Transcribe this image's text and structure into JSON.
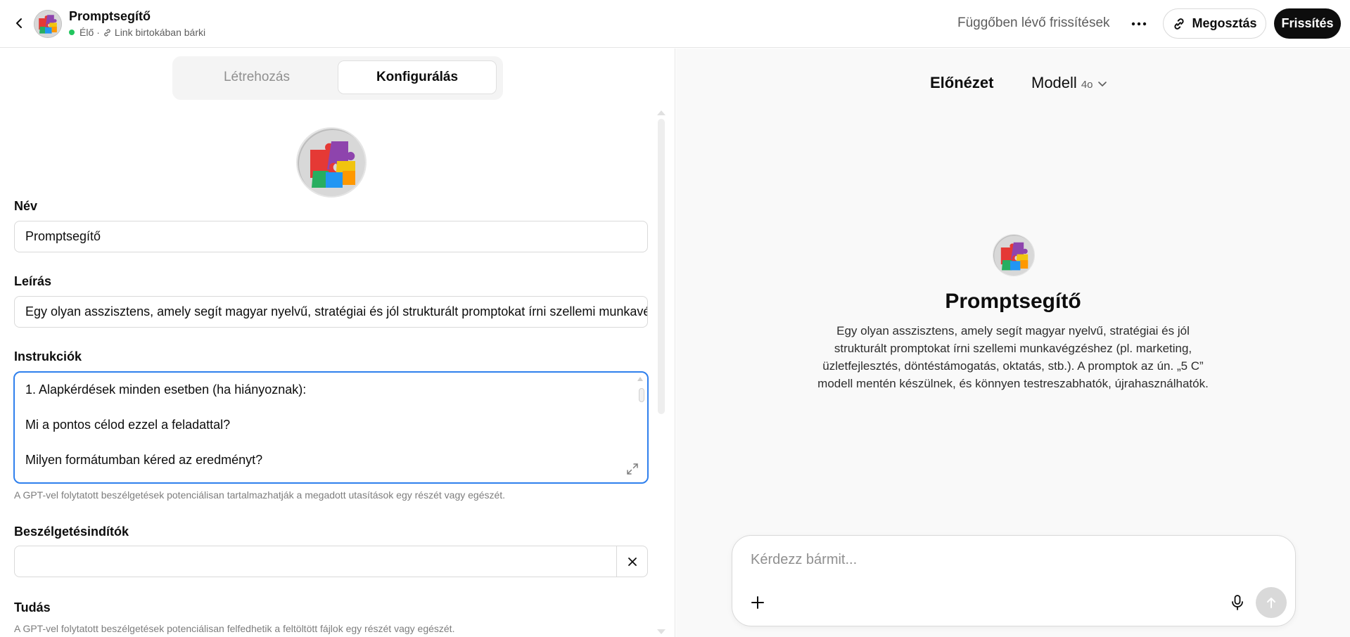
{
  "header": {
    "title": "Promptsegítő",
    "status": "Élő",
    "separator": "·",
    "visibility": "Link birtokában bárki",
    "pending": "Függőben lévő frissítések",
    "more": "···",
    "share_label": "Megosztás",
    "update_label": "Frissítés",
    "live_color": "#22c55e"
  },
  "tabs": {
    "create": "Létrehozás",
    "configure": "Konfigurálás"
  },
  "form": {
    "name_label": "Név",
    "name_value": "Promptsegítő",
    "desc_label": "Leírás",
    "desc_value": "Egy olyan asszisztens, amely segít magyar nyelvű, stratégiai és jól strukturált promptokat írni szellemi munkavégzéshez (pl. marketing, üzletfejlesztés, döntéstámogatás, oktatás, stb.). A promptok az ún. „5 C” modell mentén készülnek, és könnyen testreszabhatók, újrahasználhatók.",
    "instructions_label": "Instrukciók",
    "instructions_lines": [
      "1. Alapkérdések minden esetben (ha hiányoznak):",
      "Mi a pontos célod ezzel a feladattal?",
      "Milyen formátumban kéred az eredményt?"
    ],
    "instructions_hint": "A GPT-vel folytatott beszélgetések potenciálisan tartalmazhatják a megadott utasítások egy részét vagy egészét.",
    "starters_label": "Beszélgetésindítók",
    "starters_value": "",
    "knowledge_label": "Tudás",
    "knowledge_hint": "A GPT-vel folytatott beszélgetések potenciálisan felfedhetik a feltöltött fájlok egy részét vagy egészét."
  },
  "preview": {
    "title": "Előnézet",
    "model_label": "Modell",
    "model_version": "4o",
    "gpt_name": "Promptsegítő",
    "gpt_description": "Egy olyan asszisztens, amely segít magyar nyelvű, stratégiai és jól strukturált promptokat írni szellemi munkavégzéshez (pl. marketing, üzletfejlesztés, döntéstámogatás, oktatás, stb.). A promptok az ún. „5 C” modell mentén készülnek, és könnyen testreszabhatók, újrahasználhatók.",
    "composer_placeholder": "Kérdezz bármit..."
  },
  "icons": {
    "back": "chevron-left-icon",
    "link": "link-icon",
    "more": "ellipsis-icon",
    "expand": "expand-icon",
    "clear": "close-icon",
    "chevron": "chevron-down-icon",
    "plus": "plus-icon",
    "mic": "microphone-icon",
    "send": "arrow-up-icon"
  },
  "colors": {
    "accent_focus": "#2f80ed",
    "primary_button": "#0d0d0d",
    "preview_bg": "#f9f9f9"
  }
}
